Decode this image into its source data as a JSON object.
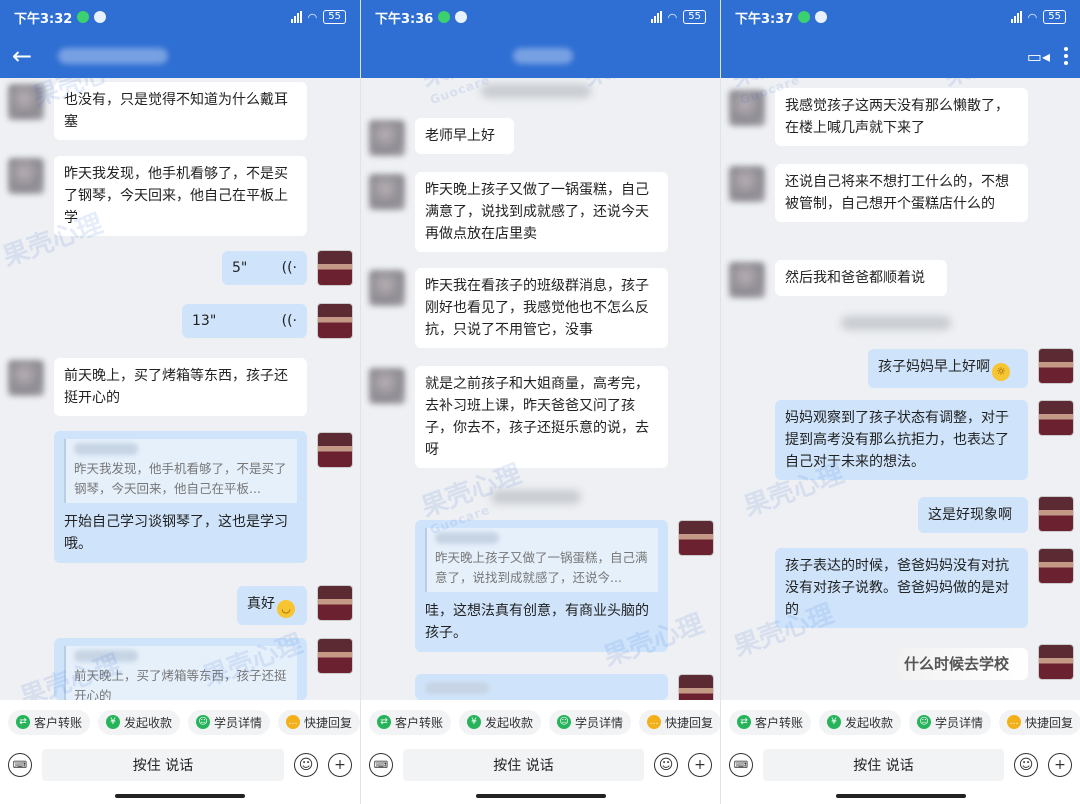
{
  "status_bar": {
    "panel1_time": "下午3:32",
    "panel2_time": "下午3:36",
    "panel3_time": "下午3:37",
    "battery": "55"
  },
  "watermark": {
    "brand": "果壳心理",
    "brand_en": "Guocare"
  },
  "colors": {
    "header": "#2f6fd3",
    "bubble_out": "#cfe4fb",
    "bubble_in": "#ffffff",
    "background": "#eef0f3"
  },
  "toolbar": {
    "transfer": "客户转账",
    "collect": "发起收款",
    "student": "学员详情",
    "quick_reply": "快捷回复",
    "hold_to_talk": "按住 说话"
  },
  "panel1": {
    "m1": "也没有，只是觉得不知道为什么戴耳塞",
    "m2": "昨天我发现，他手机看够了，不是买了钢琴，今天回来，他自己在平板上学",
    "voice1": "5\"",
    "voice2": "13\"",
    "m3": "前天晚上，买了烤箱等东西，孩子还挺开心的",
    "q1_quote": "昨天我发现，他手机看够了，不是买了钢琴，今天回来，他自己在平板...",
    "q1_reply": "开始自己学习谈钢琴了，这也是学习哦。",
    "r2": "真好",
    "q2_quote": "前天晚上，买了烤箱等东西，孩子还挺开心的"
  },
  "panel2": {
    "m1": "老师早上好",
    "m2": "昨天晚上孩子又做了一锅蛋糕，自己满意了，说找到成就感了，还说今天再做点放在店里卖",
    "m3": "昨天我在看孩子的班级群消息，孩子刚好也看见了，我感觉他也不怎么反抗，只说了不用管它，没事",
    "m4": "就是之前孩子和大姐商量，高考完，去补习班上课，昨天爸爸又问了孩子，你去不，孩子还挺乐意的说，去呀",
    "q_quote": "昨天晚上孩子又做了一锅蛋糕，自己满意了，说找到成就感了，还说今...",
    "q_reply": "哇，这想法真有创意，有商业头脑的孩子。"
  },
  "panel3": {
    "m1": "我感觉孩子这两天没有那么懒散了，在楼上喊几声就下来了",
    "m2": "还说自己将来不想打工什么的，不想被管制，自己想开个蛋糕店什么的",
    "m3": "然后我和爸爸都顺着说",
    "r1": "孩子妈妈早上好啊",
    "r2": "妈妈观察到了孩子状态有调整，对于提到高考没有那么抗拒力，也表达了自己对于未来的想法。",
    "r3": "这是好现象啊",
    "r4": "孩子表达的时候，爸爸妈妈没有对抗没有对孩子说教。爸爸妈妈做的是对的",
    "r5": "什么时候去学校"
  }
}
